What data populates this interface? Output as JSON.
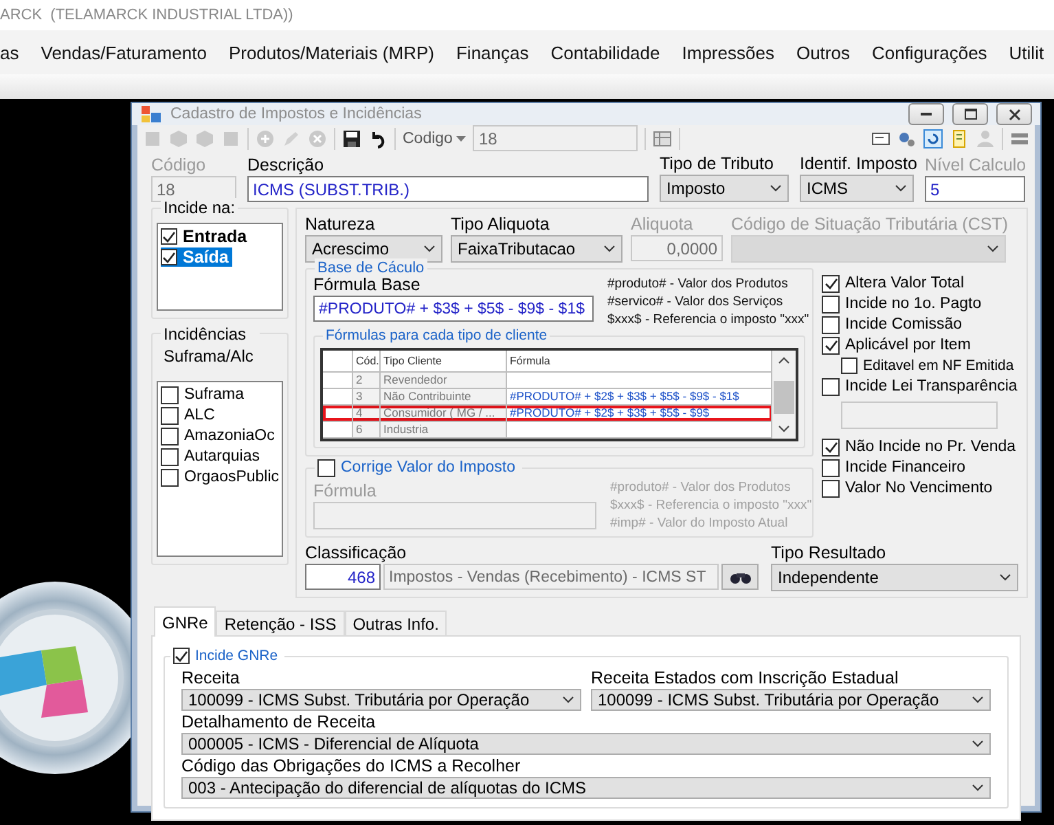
{
  "app": {
    "title": "ARCK  (TELAMARCK INDUSTRIAL LTDA))",
    "menu": [
      "as",
      "Vendas/Faturamento",
      "Produtos/Materiais (MRP)",
      "Finanças",
      "Contabilidade",
      "Impressões",
      "Outros",
      "Configurações",
      "Utilit"
    ]
  },
  "dialog": {
    "title": "Cadastro de Impostos e Incidências",
    "toolbar": {
      "code_label": "Codigo",
      "code_value": "18"
    },
    "header_fields": [
      {
        "label": "Código",
        "value": "18",
        "kind": "text",
        "label_greyed": true,
        "read_only": true
      },
      {
        "label": "Descrição",
        "value": "ICMS (SUBST.TRIB.)",
        "kind": "text",
        "label_greyed": false,
        "read_only": false
      },
      {
        "label": "Tipo de Tributo",
        "value": "Imposto",
        "kind": "select",
        "label_greyed": false
      },
      {
        "label": "Identif. Imposto",
        "value": "ICMS",
        "kind": "select",
        "label_greyed": false
      },
      {
        "label": "Nível Calculo",
        "value": "5",
        "kind": "text",
        "label_greyed": true,
        "read_only": false
      }
    ],
    "incide_na": {
      "label": "Incide na:",
      "items": [
        {
          "label": "Entrada",
          "checked": true,
          "selected": false
        },
        {
          "label": "Saída",
          "checked": true,
          "selected": true
        }
      ]
    },
    "incidencias": {
      "label": "Incidências Suframa/Alc",
      "items": [
        {
          "label": "Suframa",
          "checked": false
        },
        {
          "label": "ALC",
          "checked": false
        },
        {
          "label": "AmazoniaOc",
          "checked": false
        },
        {
          "label": "Autarquias",
          "checked": false
        },
        {
          "label": "OrgaosPublic",
          "checked": false
        }
      ]
    },
    "tax_fields": [
      {
        "label": "Natureza",
        "value": "Acrescimo",
        "kind": "select",
        "disabled": false
      },
      {
        "label": "Tipo Aliquota",
        "value": "FaixaTributacao",
        "kind": "select",
        "disabled": false
      },
      {
        "label": "Aliquota",
        "value": "0,0000",
        "kind": "text",
        "disabled": true
      },
      {
        "label": "Código de Situação Tributária (CST)",
        "kind": "select",
        "disabled": true
      }
    ],
    "base_calculo": {
      "legend": "Base de Cáculo",
      "formula_label": "Fórmula Base",
      "formula": "#PRODUTO# + $3$ + $5$ - $9$ - $1$",
      "hints": [
        "#produto# - Valor dos Produtos",
        "#servico# - Valor dos Serviços",
        "$xxx$ - Referencia o imposto \"xxx\""
      ],
      "table": {
        "legend": "Fórmulas para cada tipo de cliente",
        "columns": [
          "Cód.",
          "Tipo Cliente",
          "Fórmula"
        ],
        "rows": [
          {
            "cod": "2",
            "tipo": "Revendedor",
            "formula": "",
            "highlighted": false
          },
          {
            "cod": "3",
            "tipo": "Não Contribuinte",
            "formula": "#PRODUTO# + $2$ + $3$ + $5$ - $9$ - $1$",
            "highlighted": false
          },
          {
            "cod": "4",
            "tipo": "Consumidor ( MG / ...",
            "formula": "#PRODUTO# + $2$ + $3$ + $5$ - $9$",
            "highlighted": true
          },
          {
            "cod": "6",
            "tipo": "Industria",
            "formula": "",
            "highlighted": false
          }
        ]
      }
    },
    "corrige": {
      "label": "Corrige Valor do Imposto",
      "checked": false,
      "formula_label": "Fórmula",
      "hints": [
        "#produto# - Valor dos Produtos",
        "$xxx$ - Referencia o imposto \"xxx\"",
        "#imp# - Valor do Imposto Atual"
      ]
    },
    "options": [
      {
        "kind": "checkbox",
        "label": "Altera Valor Total",
        "checked": true
      },
      {
        "kind": "checkbox",
        "label": "Incide no 1o. Pagto",
        "checked": false
      },
      {
        "kind": "checkbox",
        "label": "Incide Comissão",
        "checked": false
      },
      {
        "kind": "checkbox",
        "label": "Aplicável por Item",
        "checked": true,
        "children": [
          {
            "kind": "checkbox",
            "label": "Editavel em NF Emitida",
            "checked": false
          }
        ]
      },
      {
        "kind": "checkbox",
        "label": "Incide Lei Transparência",
        "checked": false
      },
      {
        "kind": "field"
      },
      {
        "kind": "checkbox",
        "label": "Não Incide no Pr. Venda",
        "checked": true
      },
      {
        "kind": "checkbox",
        "label": "Incide Financeiro",
        "checked": false
      },
      {
        "kind": "checkbox",
        "label": "Valor No Vencimento",
        "checked": false
      }
    ],
    "classificacao": {
      "label": "Classificação",
      "code": "468",
      "description": "Impostos - Vendas (Recebimento) - ICMS ST"
    },
    "tipo_resultado": {
      "label": "Tipo Resultado",
      "value": "Independente"
    },
    "tabs": [
      {
        "label": "GNRe",
        "selected": true
      },
      {
        "label": "Retenção - ISS",
        "selected": false
      },
      {
        "label": "Outras Info.",
        "selected": false
      }
    ],
    "gnre": {
      "label": "Incide GNRe",
      "checked": true,
      "fields": [
        {
          "label": "Receita",
          "value": "100099 - ICMS Subst. Tributária por Operação",
          "kind": "half"
        },
        {
          "label": "Receita Estados com Inscrição Estadual",
          "value": "100099 - ICMS Subst. Tributária por Operação",
          "kind": "half"
        },
        {
          "label": "Detalhamento de Receita",
          "value": "000005 - ICMS - Diferencial de Alíquota",
          "kind": "full"
        },
        {
          "label": "Código das Obrigações do ICMS a Recolher",
          "value": "003 - Antecipação do diferencial de alíquotas do ICMS",
          "kind": "full"
        }
      ]
    }
  }
}
